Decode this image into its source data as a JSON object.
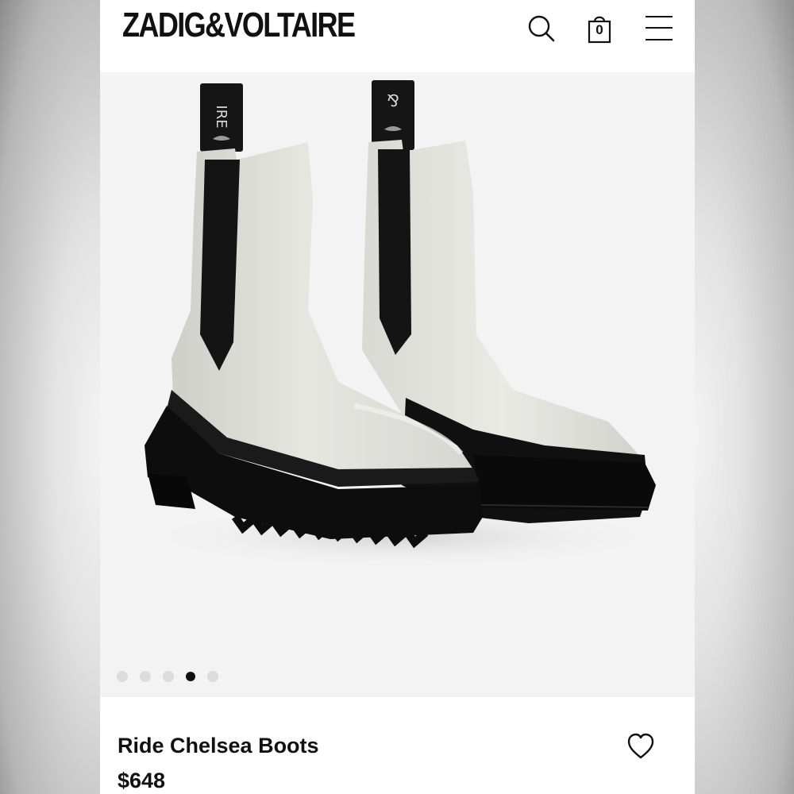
{
  "header": {
    "brand": "ZADIG&VOLTAIRE",
    "cart_count": "0",
    "icons": {
      "search": "search-icon",
      "cart": "shopping-bag-icon",
      "menu": "hamburger-menu-icon"
    }
  },
  "gallery": {
    "image": "white-leather-chelsea-boots-with-black-lug-soles",
    "total_slides": 5,
    "active_slide": 4
  },
  "product": {
    "name": "Ride Chelsea Boots",
    "price": "$648",
    "wishlist_icon": "heart-icon"
  },
  "colors": {
    "text": "#111111",
    "gallery_bg": "#f3f3f3",
    "dot_inactive": "#dcdcdc",
    "dot_active": "#111111"
  }
}
